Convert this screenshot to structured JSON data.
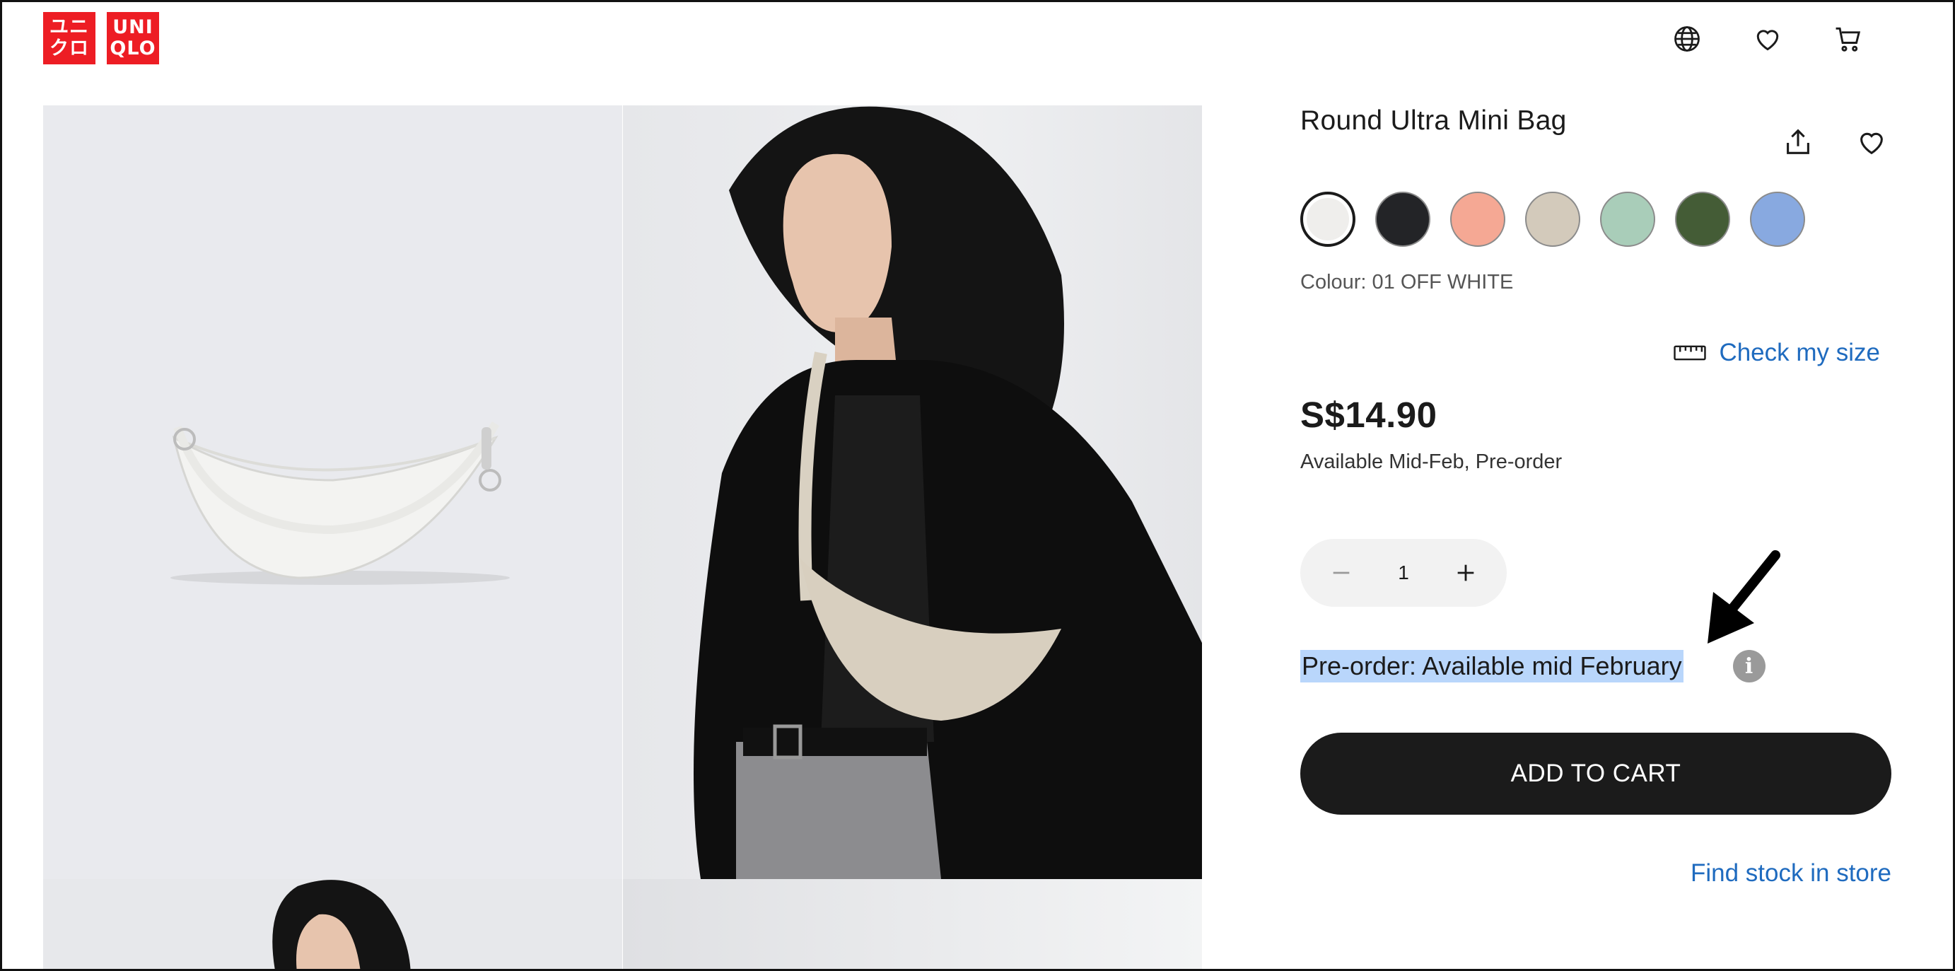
{
  "header": {
    "logo": {
      "block1": [
        "ユニ",
        "クロ"
      ],
      "block2": [
        "UNI",
        "QLO"
      ],
      "color": "#ed1d24"
    },
    "icons": [
      "globe-icon",
      "heart-icon",
      "cart-icon"
    ]
  },
  "product": {
    "title": "Round Ultra Mini Bag",
    "colours": [
      {
        "name": "01 OFF WHITE",
        "hex": "#efeeec",
        "selected": true
      },
      {
        "name": "black",
        "hex": "#232427"
      },
      {
        "name": "pink",
        "hex": "#f5a894"
      },
      {
        "name": "beige",
        "hex": "#d3cabb"
      },
      {
        "name": "mint",
        "hex": "#a9cdb9"
      },
      {
        "name": "olive",
        "hex": "#445c36"
      },
      {
        "name": "blue",
        "hex": "#88a9e0"
      }
    ],
    "colour_label": "Colour: 01 OFF WHITE",
    "check_size": "Check my size",
    "price": "S$14.90",
    "availability": "Available Mid-Feb, Pre-order",
    "quantity": "1",
    "preorder_note": "Pre-order: Available mid February",
    "info_icon_glyph": "i",
    "add_to_cart": "ADD TO CART",
    "find_stock": "Find stock in store"
  },
  "colors": {
    "link": "#1f6bbf",
    "highlight": "#b9d6fb",
    "button": "#1b1b1b"
  }
}
